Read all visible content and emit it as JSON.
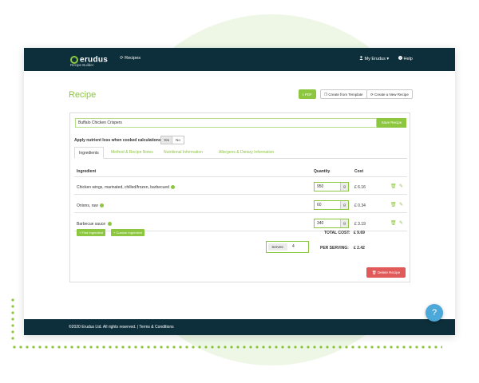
{
  "header": {
    "logo_text": "erudus",
    "logo_subtitle": "Recipe Builder",
    "nav_recipes": "Recipes",
    "my_account": "My Erudus",
    "help": "Help"
  },
  "page": {
    "title": "Recipe",
    "buttons": {
      "pdf": "PDF",
      "create_from_template": "Create from Template",
      "create_new": "Create a New Recipe"
    }
  },
  "recipe": {
    "name": "Buffalo Chicken Crispers",
    "save_label": "Save Recipe",
    "nutrient_question": "Apply nutrient loss when cooked calculations :",
    "toggle": {
      "yes": "Yes",
      "no": "No",
      "selected": "Yes"
    }
  },
  "tabs": [
    {
      "label": "Ingredients",
      "active": true
    },
    {
      "label": "Method & Recipe Notes",
      "active": false
    },
    {
      "label": "Nutritional Information",
      "active": false
    },
    {
      "label": "Allergens & Dietary Information",
      "active": false
    }
  ],
  "table": {
    "headers": {
      "ingredient": "Ingredient",
      "quantity": "Quantity",
      "cost": "Cost"
    },
    "rows": [
      {
        "name": "Chicken wings, marinated, chilled/frozen, barbecued",
        "quantity": "950",
        "unit": "g",
        "cost": "£ 6.16"
      },
      {
        "name": "Onions, raw",
        "quantity": "60",
        "unit": "g",
        "cost": "£ 0.34"
      },
      {
        "name": "Barbecue sauce",
        "quantity": "340",
        "unit": "g",
        "cost": "£ 3.19"
      }
    ]
  },
  "actions": {
    "find_ingredient": "Find Ingredient",
    "custom_ingredient": "Custom Ingredient"
  },
  "totals": {
    "total_cost_label": "TOTAL COST:",
    "total_cost": "£ 9.69",
    "serves_label": "Serves:",
    "serves": "4",
    "per_serving_label": "PER SERVING:",
    "per_serving": "£ 2.42"
  },
  "delete_label": "Delete Recipe",
  "footer": {
    "text": "©2020 Erudus Ltd. All rights reserved. | Terms & Conditions"
  },
  "help_fab": "?",
  "colors": {
    "accent": "#8dc63f",
    "header": "#0d2f3b",
    "danger": "#e05a5a",
    "help": "#4ba8d8"
  },
  "icons": {
    "logo": "erudus-logo-icon",
    "recipes": "refresh-icon",
    "user": "user-icon",
    "help": "help-circle-icon",
    "pdf": "download-icon",
    "template": "copy-icon",
    "new_recipe": "refresh-icon",
    "info": "info-icon",
    "delete": "trash-icon",
    "edit": "pencil-icon",
    "add": "plus-icon"
  }
}
